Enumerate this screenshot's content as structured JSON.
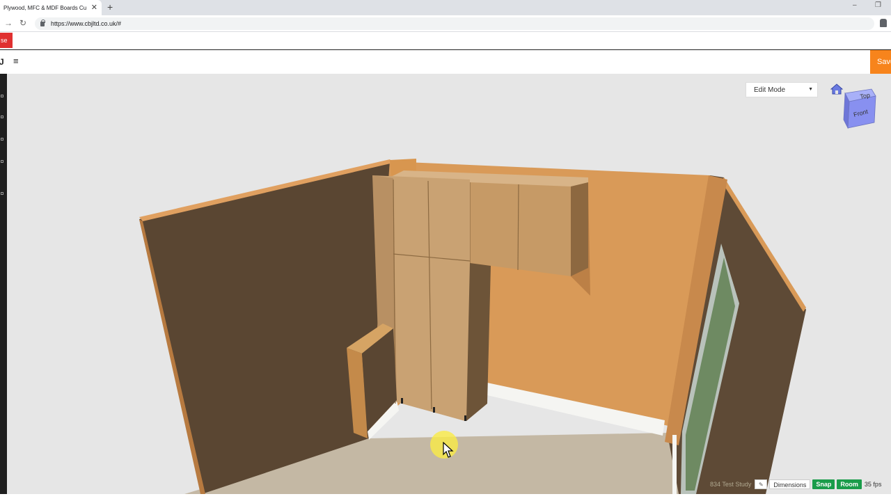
{
  "browser": {
    "tab_title": "Plywood, MFC & MDF Boards Cu",
    "tab_close": "✕",
    "new_tab": "+",
    "minimize": "–",
    "restore": "❐",
    "url": "https://www.cbjltd.co.uk/#"
  },
  "site": {
    "red_button_label": "se",
    "logo_fragment": "J",
    "menu_icon": "≡",
    "save_label": "Save"
  },
  "viewer": {
    "mode_select": {
      "value": "Edit Mode"
    },
    "viewcube": {
      "top_label": "Top",
      "front_label": "Front"
    },
    "status": {
      "room_name": "834 Test Study",
      "dimensions_label": "Dimensions",
      "snap_label": "Snap",
      "room_label": "Room",
      "fps": "35 fps"
    }
  },
  "colors": {
    "accent_orange": "#f7841c",
    "accent_red": "#e03030",
    "status_green": "#1a9c4a",
    "wall_back": "#d99a58",
    "wall_left": "#5a4632",
    "floor": "#c4b8a4"
  }
}
